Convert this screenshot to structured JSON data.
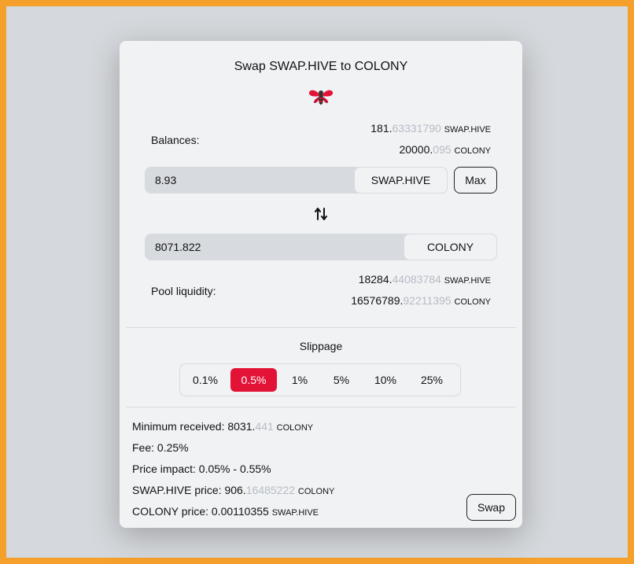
{
  "title": "Swap SWAP.HIVE to COLONY",
  "logo_icon": "bee-icon",
  "balances": {
    "label": "Balances:",
    "from": {
      "int": "181.",
      "dec": "63331790",
      "unit": "SWAP.HIVE"
    },
    "to": {
      "int": "20000.",
      "dec": "095",
      "unit": "COLONY"
    }
  },
  "from_input": {
    "value": "8.93",
    "token": "SWAP.HIVE"
  },
  "max_label": "Max",
  "swap_direction_icon": "swap-arrows-icon",
  "to_input": {
    "value": "8071.822",
    "token": "COLONY"
  },
  "pool": {
    "label": "Pool liquidity:",
    "from": {
      "int": "18284.",
      "dec": "44083784",
      "unit": "SWAP.HIVE"
    },
    "to": {
      "int": "16576789.",
      "dec": "92211395",
      "unit": "COLONY"
    }
  },
  "slippage": {
    "label": "Slippage",
    "options": [
      "0.1%",
      "0.5%",
      "1%",
      "5%",
      "10%",
      "25%"
    ],
    "selected": "0.5%"
  },
  "info": {
    "min_received": {
      "label": "Minimum received: ",
      "int": "8031.",
      "dec": "441",
      "unit": "COLONY"
    },
    "fee": "Fee: 0.25%",
    "price_impact": "Price impact: 0.05% - 0.55%",
    "swaphive_price": {
      "label": "SWAP.HIVE price: ",
      "int": "906.",
      "dec": "16485222",
      "unit": "COLONY"
    },
    "colony_price": {
      "label": "COLONY price: ",
      "value": "0.00110355",
      "unit": "SWAP.HIVE"
    }
  },
  "swap_label": "Swap",
  "colors": {
    "accent": "#e31337",
    "frame": "#f5a02a",
    "muted": "#b5bcc5"
  }
}
